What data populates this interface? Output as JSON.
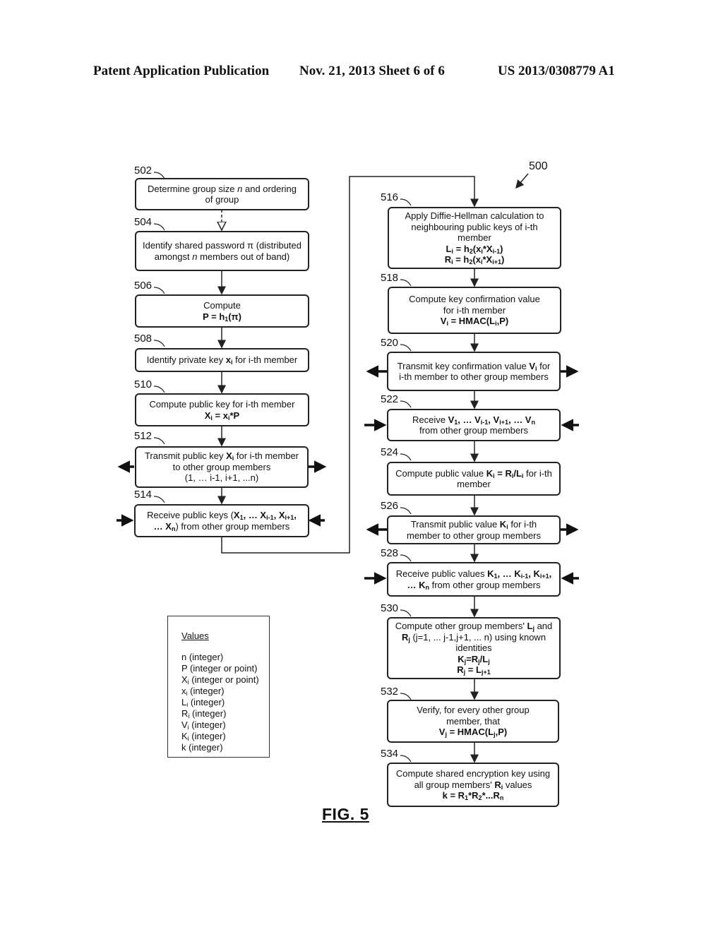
{
  "header": {
    "left": "Patent Application Publication",
    "center": "Nov. 21, 2013   Sheet 6 of 6",
    "right": "US 2013/0308779 A1"
  },
  "diagram_ref": "500",
  "figure_label": "FIG. 5",
  "steps": [
    {
      "id": "502",
      "lines": [
        "Determine group size <i>n</i> and ordering",
        "of group"
      ]
    },
    {
      "id": "504",
      "lines": [
        "Identify shared password &pi; (distributed",
        "amongst <i>n</i> members out of band)"
      ]
    },
    {
      "id": "506",
      "lines": [
        "Compute",
        "<b>P = h<sub>1</sub>(&pi;)</b>"
      ]
    },
    {
      "id": "508",
      "lines": [
        "Identify private key <b>x<sub>i</sub></b> for i-th member"
      ]
    },
    {
      "id": "510",
      "lines": [
        "Compute public key for i-th member",
        "<b>X<sub>i</sub> = x<sub>i</sub>*P</b>"
      ]
    },
    {
      "id": "512",
      "lines": [
        "Transmit public key <b>X<sub>i</sub></b> for i-th member",
        "to other group members",
        "(1, … i-1, i+1, ...n)"
      ]
    },
    {
      "id": "514",
      "lines": [
        "Receive public keys (<b>X<sub>1</sub>, … X<sub>i-1</sub>, X<sub>i+1</sub>,</b>",
        "<b>… X<sub>n</sub></b>) from other group members"
      ]
    },
    {
      "id": "516",
      "lines": [
        "Apply Diffie-Hellman calculation to",
        "neighbouring public keys of i-th",
        "member",
        "<b>L<sub>i</sub> = h<sub>2</sub>(x<sub>i</sub>*X<sub>i-1</sub>)</b>",
        "<b>R<sub>i</sub> = h<sub>2</sub>(x<sub>i</sub>*X<sub>i+1</sub>)</b>"
      ]
    },
    {
      "id": "518",
      "lines": [
        "Compute key confirmation value",
        "for i-th member",
        "<b>V<sub>i</sub> = HMAC(L<sub>i</sub>,P)</b>"
      ]
    },
    {
      "id": "520",
      "lines": [
        "Transmit key confirmation value <b>V<sub>i</sub></b>  for",
        "i-th member to other group members"
      ]
    },
    {
      "id": "522",
      "lines": [
        "Receive <b>V<sub>1</sub>, … V<sub>i-1</sub>, V<sub>i+1</sub>, … V<sub>n</sub></b>",
        "from other group members"
      ]
    },
    {
      "id": "524",
      "lines": [
        "Compute public value <b>K<sub>i</sub> = R<sub>i</sub>/L<sub>i</sub></b> for i-th",
        "member"
      ]
    },
    {
      "id": "526",
      "lines": [
        "Transmit public value <b>K<sub>i</sub></b>  for i-th",
        "member to other group members"
      ]
    },
    {
      "id": "528",
      "lines": [
        "Receive public values <b>K<sub>1</sub>, … K<sub>i-1</sub>, K<sub>i+1</sub>,</b>",
        "<b>… K<sub>n</sub></b> from other group members"
      ]
    },
    {
      "id": "530",
      "lines": [
        "Compute other group members' <b>L<sub>j</sub></b> and",
        "<b>R<sub>j</sub></b> (j=1, ... j-1,j+1, ... n) using known",
        "identities",
        "<b>K<sub>j</sub>=R<sub>j</sub>/L<sub>j</sub></b>",
        "<b>R<sub>j</sub> = L<sub>j+1</sub></b>"
      ]
    },
    {
      "id": "532",
      "lines": [
        "Verify, for every other group",
        "member, that",
        "<b>V<sub>j</sub> = HMAC(L<sub>j</sub>,P)</b>"
      ]
    },
    {
      "id": "534",
      "lines": [
        "Compute shared encryption key using",
        "all group members' <b>R<sub>i</sub></b> values",
        "<b>k = R<sub>1</sub>*R<sub>2</sub>*...R<sub>n</sub></b>"
      ]
    }
  ],
  "legend": {
    "title": "Values",
    "rows": [
      "n (integer)",
      "P (integer or point)",
      "X<sub>i</sub> (integer or point)",
      "x<sub>i</sub> (integer)",
      "L<sub>i</sub> (integer)",
      "R<sub>i</sub> (integer)",
      "V<sub>i</sub> (integer)",
      "K<sub>i</sub> (integer)",
      "k (integer)"
    ]
  }
}
